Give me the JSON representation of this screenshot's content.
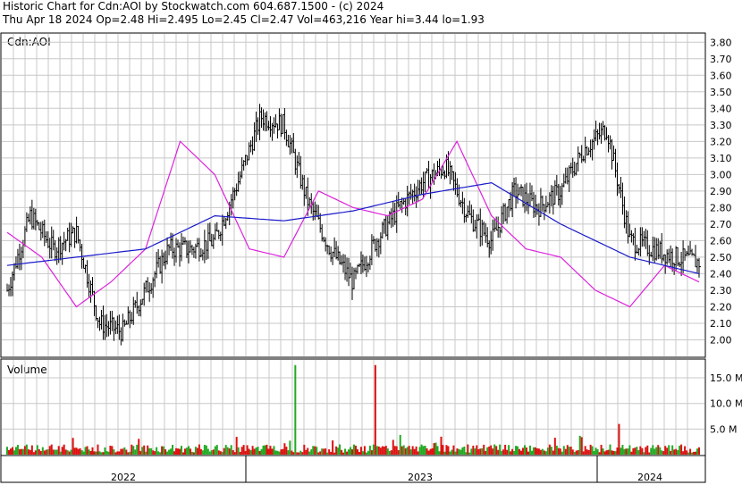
{
  "header": {
    "line1": "Historic Chart for Cdn:AOI by Stockwatch.com 604.687.1500 - (c) 2024",
    "line2": "Thu Apr 18 2024  Op=2.48  Hi=2.495  Lo=2.45  Cl=2.47  Vol=463,216  Year hi=3.44  lo=1.93"
  },
  "colors": {
    "ma_short": "#dd22dd",
    "ma_long": "#1a1acc",
    "volume_up": "#22aa22",
    "volume_down": "#dd1111",
    "grid": "#c8c8c8"
  },
  "chart_data": [
    {
      "type": "line",
      "panel": "price",
      "symbol_label": "Cdn:AOI",
      "ylim": [
        1.9,
        3.85
      ],
      "y_ticks": [
        "3.80",
        "3.70",
        "3.60",
        "3.50",
        "3.40",
        "3.30",
        "3.20",
        "3.10",
        "3.00",
        "2.90",
        "2.80",
        "2.70",
        "2.60",
        "2.50",
        "2.40",
        "2.30",
        "2.20",
        "2.10",
        "2.00"
      ],
      "x_labels": [
        "2022",
        "2023",
        "2024"
      ],
      "grid": true,
      "series": [
        {
          "style": "ohlc-bars",
          "x": [
            0,
            2,
            4,
            6,
            8,
            10,
            12,
            14,
            16,
            18,
            20,
            22,
            24,
            26,
            28,
            30,
            32,
            34,
            36,
            38,
            40,
            42,
            44,
            46,
            48,
            50,
            52,
            54,
            56,
            58,
            60
          ],
          "close": [
            2.3,
            2.75,
            2.55,
            2.65,
            2.1,
            2.05,
            2.3,
            2.55,
            2.55,
            2.6,
            2.95,
            3.35,
            3.3,
            2.85,
            2.55,
            2.35,
            2.6,
            2.8,
            2.95,
            3.05,
            2.75,
            2.6,
            2.9,
            2.8,
            2.9,
            3.15,
            3.28,
            2.6,
            2.55,
            2.5,
            2.47
          ]
        },
        {
          "style": "moving-average-short",
          "x": [
            0,
            3,
            6,
            9,
            12,
            15,
            18,
            21,
            24,
            27,
            30,
            33,
            36,
            39,
            42,
            45,
            48,
            51,
            54,
            57,
            60
          ],
          "values": [
            2.65,
            2.5,
            2.2,
            2.35,
            2.55,
            3.2,
            3.0,
            2.55,
            2.5,
            2.9,
            2.8,
            2.75,
            2.85,
            3.2,
            2.75,
            2.55,
            2.5,
            2.3,
            2.2,
            2.45,
            2.35
          ]
        },
        {
          "style": "moving-average-long",
          "x": [
            0,
            6,
            12,
            18,
            24,
            30,
            36,
            42,
            48,
            54,
            60
          ],
          "values": [
            2.45,
            2.5,
            2.55,
            2.75,
            2.72,
            2.78,
            2.88,
            2.95,
            2.7,
            2.5,
            2.4
          ]
        }
      ]
    },
    {
      "type": "bar",
      "panel": "volume",
      "title": "Volume",
      "ylim": [
        0,
        18.5
      ],
      "y_ticks": [
        "15.0 M",
        "10.0 M",
        "5.0 M"
      ],
      "spikes": [
        {
          "x": 25,
          "value": 17.5,
          "direction": "up"
        },
        {
          "x": 32,
          "value": 17.5,
          "direction": "down"
        },
        {
          "x": 53,
          "value": 6.0,
          "direction": "down"
        }
      ]
    }
  ]
}
